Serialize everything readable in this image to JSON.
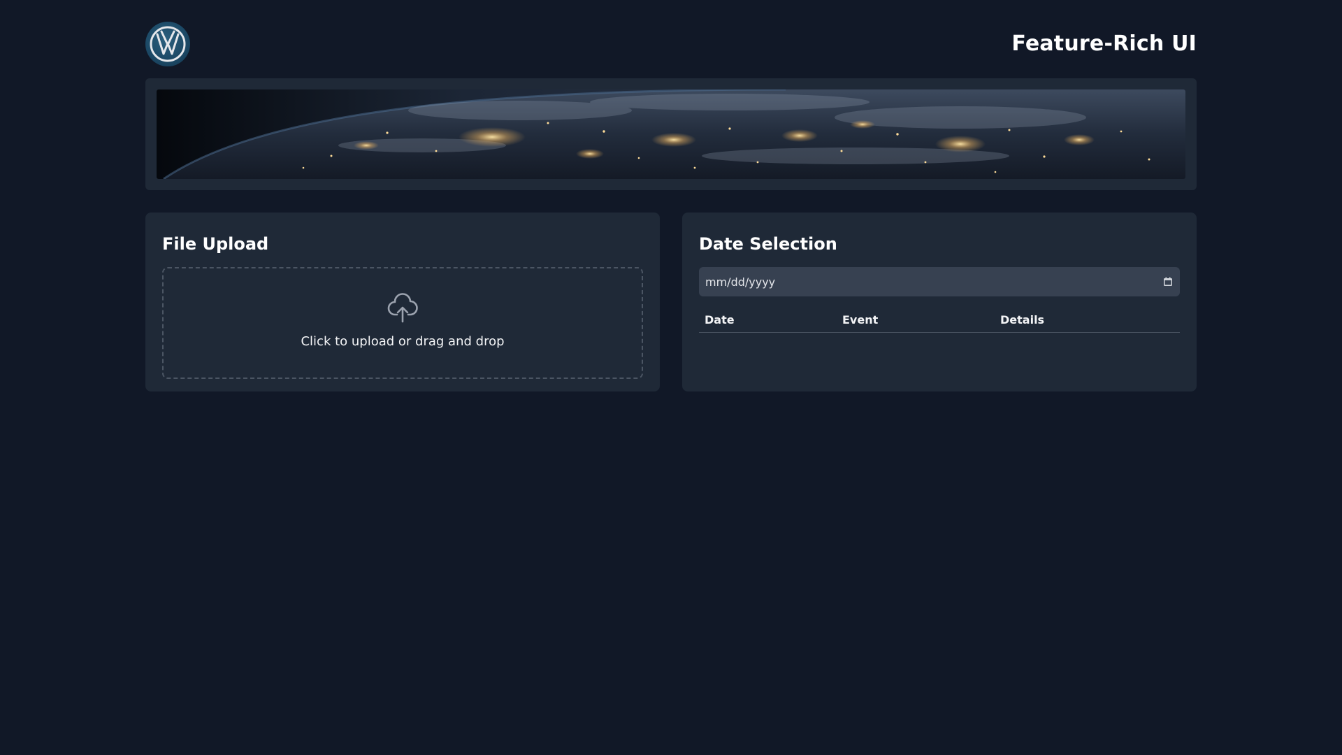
{
  "header": {
    "title": "Feature-Rich UI",
    "logo_icon": "vw-logo-icon"
  },
  "banner": {
    "image": "earth-at-night-banner"
  },
  "upload": {
    "title": "File Upload",
    "prompt": "Click to upload or drag and drop",
    "icon": "cloud-upload-icon"
  },
  "date": {
    "title": "Date Selection",
    "placeholder": "mm/dd/yyyy",
    "icon": "calendar-icon",
    "table": {
      "headers": [
        "Date",
        "Event",
        "Details"
      ],
      "rows": []
    }
  },
  "colors": {
    "background": "#111827",
    "card": "#1f2937",
    "input": "#374151",
    "border": "#4b5563"
  }
}
